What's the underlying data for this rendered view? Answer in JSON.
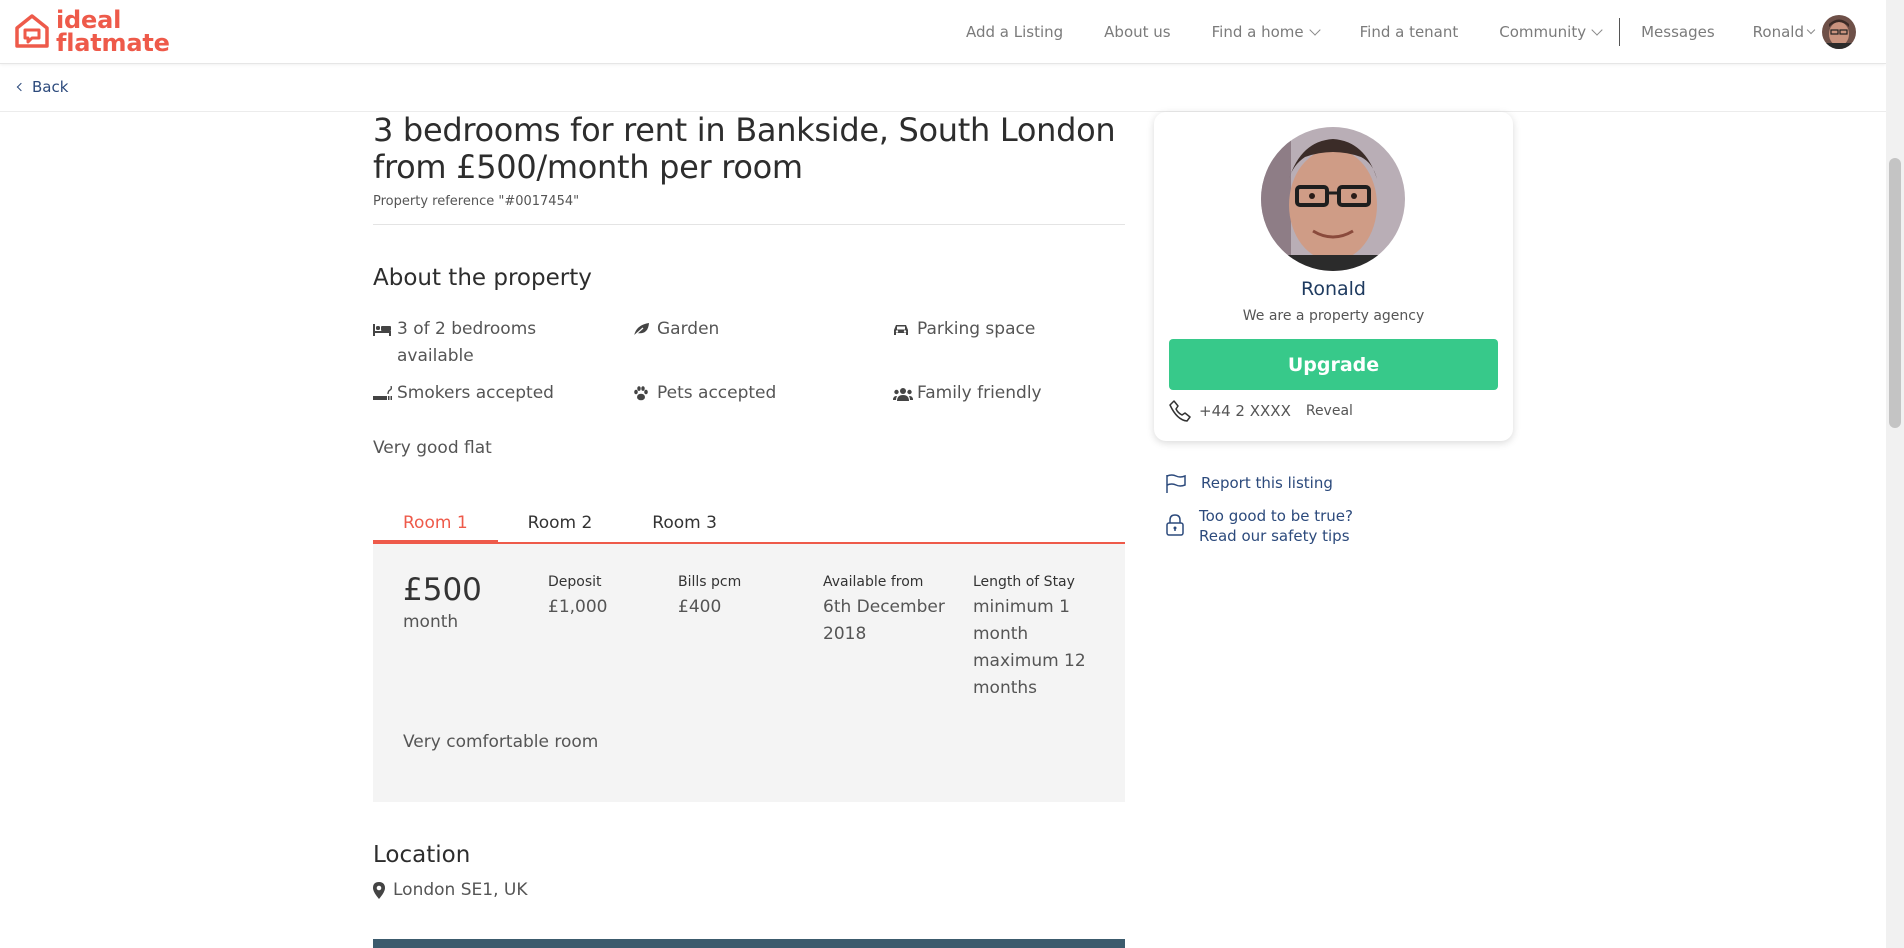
{
  "header": {
    "logo_line1": "ideal",
    "logo_line2": "flatmate",
    "nav": {
      "add_listing": "Add a Listing",
      "about": "About us",
      "find_home": "Find a home",
      "find_tenant": "Find a tenant",
      "community": "Community",
      "messages": "Messages",
      "user": "Ronald"
    }
  },
  "back_label": "Back",
  "listing": {
    "title_line1": "3 bedrooms for rent in Bankside, South London",
    "title_line2": "from £500/month per room",
    "reference": "Property reference \"#0017454\"",
    "about_heading": "About the property",
    "features": {
      "bedrooms": "3 of 2 bedrooms available",
      "garden": "Garden",
      "parking": "Parking space",
      "smokers": "Smokers accepted",
      "pets": "Pets accepted",
      "family": "Family friendly"
    },
    "description": "Very good flat",
    "tabs": [
      "Room 1",
      "Room 2",
      "Room 3"
    ],
    "room": {
      "price": "£500",
      "price_unit": "month",
      "deposit_label": "Deposit",
      "deposit": "£1,000",
      "bills_label": "Bills pcm",
      "bills": "£400",
      "available_label": "Available from",
      "available": "6th December 2018",
      "stay_label": "Length of Stay",
      "stay": "minimum 1 month maximum 12 months",
      "description": "Very comfortable room"
    },
    "location_heading": "Location",
    "location": "London SE1, UK"
  },
  "card": {
    "name": "Ronald",
    "subtitle": "We are a property agency",
    "upgrade": "Upgrade",
    "phone": "+44 2 XXXX",
    "reveal": "Reveal"
  },
  "side_links": {
    "report": "Report this listing",
    "safety_line1": "Too good to be true?",
    "safety_line2": "Read our safety tips"
  },
  "colors": {
    "brand": "#ee5a4a",
    "upgrade": "#37c98a",
    "link": "#2c4a7c"
  }
}
